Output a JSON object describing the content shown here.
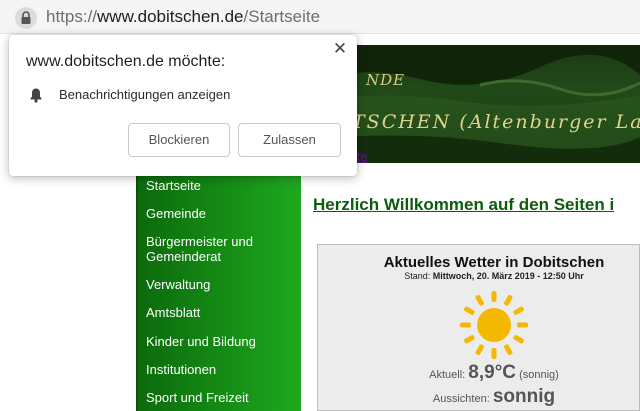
{
  "browser": {
    "url_scheme": "https://",
    "url_host": "www.dobitschen.de",
    "url_path": "/Startseite",
    "lock_icon": "lock-icon"
  },
  "popup": {
    "title": "www.dobitschen.de möchte:",
    "permission": "Benachrichtigungen anzeigen",
    "block_label": "Blockieren",
    "allow_label": "Zulassen",
    "close_label": "✕"
  },
  "page": {
    "banner_line1": "NDE",
    "banner_line2": "TSCHEN (Altenburger La",
    "site_link": "ite",
    "headline": "Herzlich Willkommen auf den Seiten i",
    "nav": [
      {
        "label": "Startseite"
      },
      {
        "label": "Gemeinde"
      },
      {
        "label": "Bürgermeister und Gemeinderat"
      },
      {
        "label": "Verwaltung"
      },
      {
        "label": "Amtsblatt"
      },
      {
        "label": "Kinder und Bildung"
      },
      {
        "label": "Institutionen"
      },
      {
        "label": "Sport und Freizeit"
      }
    ]
  },
  "weather": {
    "title": "Aktuelles Wetter in Dobitschen",
    "stand_label": "Stand:",
    "stand_value": "Mittwoch, 20. März 2019 - 12:50 Uhr",
    "now_label": "Aktuell:",
    "now_value": "8,9°C",
    "now_desc": "(sonnig)",
    "fore_label": "Aussichten:",
    "fore_value": "sonnig",
    "sun_color": "#f5b800"
  }
}
